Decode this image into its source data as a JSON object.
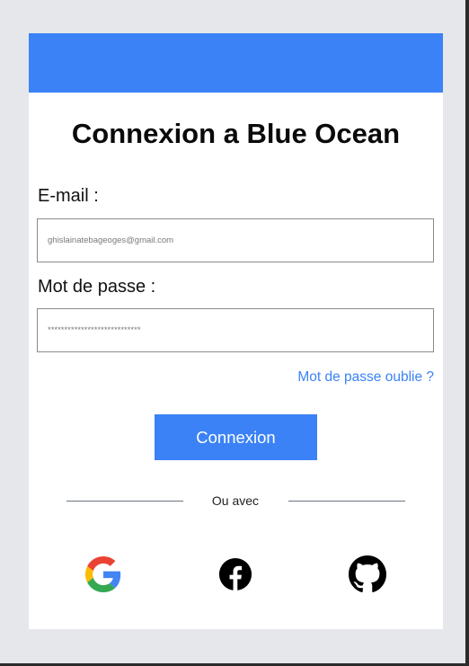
{
  "form": {
    "title": "Connexion a Blue Ocean",
    "email_label": "E-mail :",
    "email_placeholder": "ghislainatebageoges@gmail.com",
    "password_label": "Mot de passe :",
    "password_placeholder": "****************************",
    "forgot_link": "Mot de passe oublie ?",
    "submit_label": "Connexion",
    "divider_text": "Ou avec"
  },
  "social": [
    "google-icon",
    "facebook-icon",
    "github-icon"
  ],
  "colors": {
    "accent": "#3b82f6",
    "background": "#e5e7eb",
    "card": "#ffffff",
    "title_text": "#0a0a0a"
  }
}
